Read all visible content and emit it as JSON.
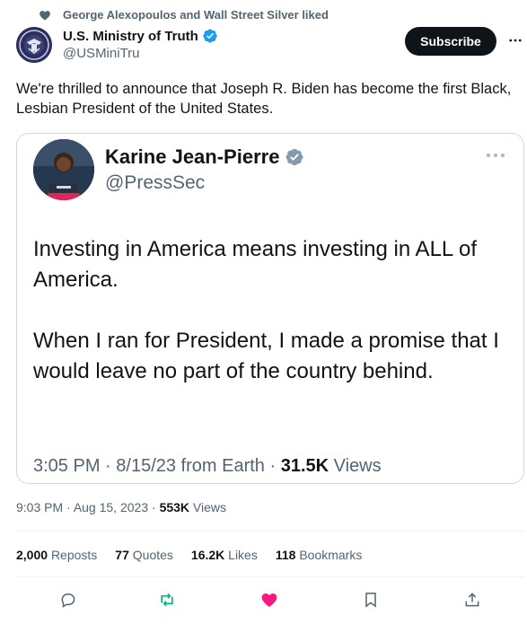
{
  "social_context": {
    "text": "George Alexopoulos and Wall Street Silver liked"
  },
  "author": {
    "name": "U.S. Ministry of Truth",
    "handle": "@USMiniTru"
  },
  "subscribe_label": "Subscribe",
  "tweet": {
    "text": "We're thrilled to announce that Joseph R. Biden has become the first Black, Lesbian President of the United States."
  },
  "quoted": {
    "name": "Karine Jean-Pierre",
    "handle": "@PressSec",
    "para1": "Investing in America means investing in ALL of America.",
    "para2": "When I ran for President, I made a promise that I would leave no part of the country behind.",
    "time": "3:05 PM",
    "date": "8/15/23 from Earth",
    "views_count": "31.5K",
    "views_label": "Views"
  },
  "meta": {
    "time": "9:03 PM",
    "date": "Aug 15, 2023",
    "views_count": "553K",
    "views_label": "Views"
  },
  "stats": {
    "reposts_count": "2,000",
    "reposts_label": "Reposts",
    "quotes_count": "77",
    "quotes_label": "Quotes",
    "likes_count": "16.2K",
    "likes_label": "Likes",
    "bookmarks_count": "118",
    "bookmarks_label": "Bookmarks"
  },
  "colors": {
    "accent": "#1d9bf0",
    "like": "#f91880",
    "repost": "#00ba7c",
    "muted": "#536471"
  },
  "icons": [
    "heart-icon",
    "verified-icon",
    "more-icon",
    "reply-icon",
    "repost-icon",
    "like-icon",
    "bookmark-icon",
    "share-icon"
  ]
}
